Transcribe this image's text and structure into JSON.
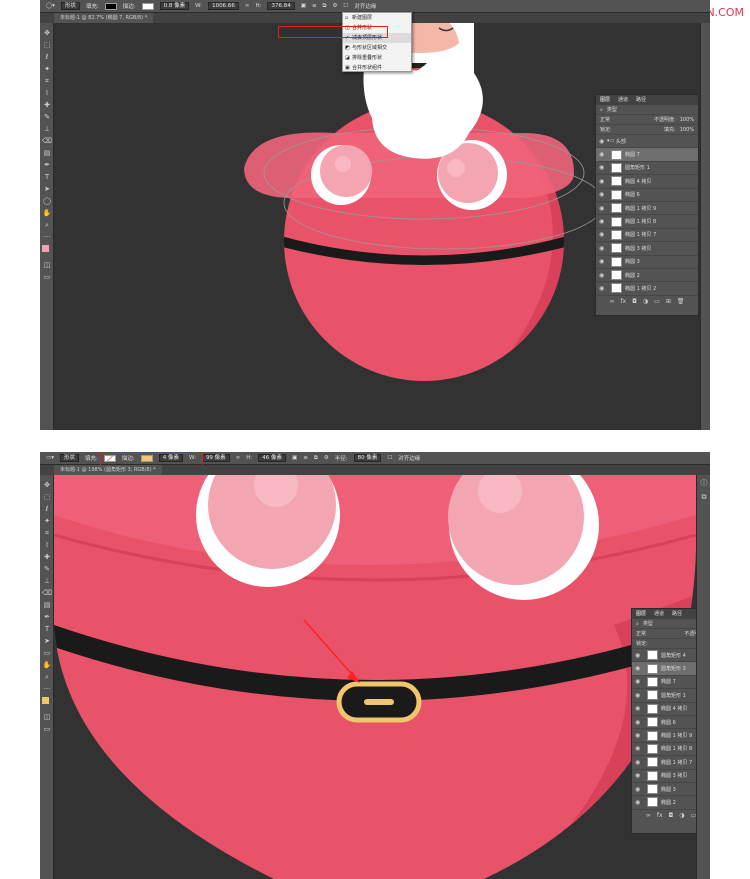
{
  "watermark": "思缘设计论坛 WWW.MISSVUAN.COM",
  "shot1": {
    "options": {
      "mode": "形状",
      "fill_label": "填充:",
      "stroke_label": "描边:",
      "stroke_width": "0.8 像素",
      "w_label": "W:",
      "w_value": "1006.66",
      "h_label": "H:",
      "h_value": "376.84",
      "align_edges": "对齐边缘"
    },
    "tab": "未标题-1 @ 82.7% (椭圆 7, RGB/8) *",
    "dropdown": {
      "items": [
        "新建图层",
        "合并形状",
        "减去顶层形状",
        "与形状区域相交",
        "排除重叠形状",
        "合并形状组件"
      ],
      "checked_index": 2
    },
    "layers_panel": {
      "tabs": [
        "图层",
        "通道",
        "路径"
      ],
      "kind": "类型",
      "blend": "正常",
      "opacity_label": "不透明度:",
      "opacity": "100%",
      "lock_label": "锁定:",
      "fill_label": "填充:",
      "fill": "100%",
      "group": "头部",
      "layers": [
        "椭圆 7",
        "圆角矩形 1",
        "椭圆 4 拷贝",
        "椭圆 6",
        "椭圆 1 拷贝 9",
        "椭圆 1 拷贝 8",
        "椭圆 1 拷贝 7",
        "椭圆 3 拷贝",
        "椭圆 3",
        "椭圆 2",
        "椭圆 1 拷贝 2"
      ]
    }
  },
  "shot2": {
    "options": {
      "mode": "形状",
      "fill_label": "填充:",
      "stroke_label": "描边:",
      "stroke_width": "4 像素",
      "w_label": "W:",
      "w_value": "99 像素",
      "h_label": "H:",
      "h_value": "46 像素",
      "radius_label": "半径:",
      "radius_value": "80 像素",
      "align_edges": "对齐边缘"
    },
    "tab": "未标题-1 @ 198% (圆角矩形 3, RGB/8) *",
    "layers_panel": {
      "tabs": [
        "图层",
        "通道",
        "路径"
      ],
      "kind": "类型",
      "blend": "正常",
      "opacity_label": "不透明度:",
      "lock_label": "锁定:",
      "layers": [
        "圆角矩形 4",
        "圆角矩形 3",
        "椭圆 7",
        "圆角矩形 1",
        "椭圆 4 拷贝",
        "椭圆 6",
        "椭圆 1 拷贝 9",
        "椭圆 1 拷贝 8",
        "椭圆 1 拷贝 7",
        "椭圆 3 拷贝",
        "椭圆 3",
        "椭圆 2"
      ]
    }
  },
  "colors": {
    "body_red": "#e9536a",
    "belt": "#1a1a1a",
    "buckle": "#f2c66a",
    "beard": "#ffffff",
    "face": "#f5b7a8",
    "cheek": "#f6a3b0",
    "ps_bg": "#323232"
  }
}
